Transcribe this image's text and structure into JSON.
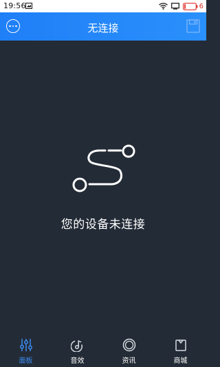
{
  "status_bar": {
    "time": "19:56",
    "battery_level": "6"
  },
  "header": {
    "title": "无连接",
    "menu_icon": "more-circle-icon",
    "save_icon": "save-icon"
  },
  "main": {
    "illustration_icon": "disconnected-route-icon",
    "message": "您的设备未连接"
  },
  "bottom_nav": {
    "items": [
      {
        "label": "面板",
        "icon": "sliders-icon",
        "active": true
      },
      {
        "label": "音效",
        "icon": "music-note-icon",
        "active": false
      },
      {
        "label": "资讯",
        "icon": "circle-icon",
        "active": false
      },
      {
        "label": "商城",
        "icon": "shopping-bag-icon",
        "active": false
      }
    ]
  },
  "colors": {
    "header_blue": "#2588f9",
    "background": "#232b36",
    "active_tab": "#3b8df5",
    "battery_low": "#e0312a"
  }
}
